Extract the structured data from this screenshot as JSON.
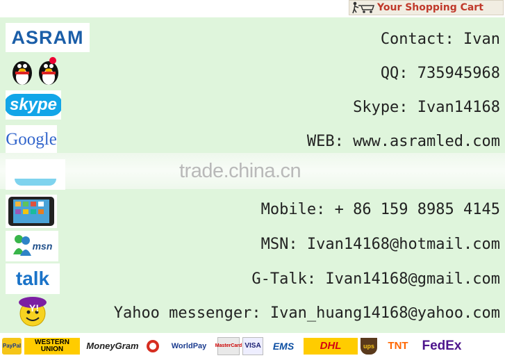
{
  "cart": {
    "label": "Your Shopping Cart",
    "icon": "cart-icon"
  },
  "contacts": {
    "logo_text": "ASRAM",
    "rows": [
      {
        "text": "Contact: Ivan",
        "icon": "asram-logo"
      },
      {
        "text": "QQ: 735945968",
        "icon": "qq-penguins-icon"
      },
      {
        "text": "Skype: Ivan14168",
        "icon": "skype-icon",
        "icon_label": "skype"
      },
      {
        "text": "WEB: www.asramled.com",
        "icon": "google-icon",
        "icon_label": "Google"
      },
      {
        "text": "",
        "icon": "blank-icon"
      },
      {
        "text": "Mobile: + 86 159 8985 4145",
        "icon": "tablet-icon"
      },
      {
        "text": "MSN: Ivan14168@hotmail.com",
        "icon": "msn-icon",
        "icon_label": "msn"
      },
      {
        "text": "G-Talk: Ivan14168@gmail.com",
        "icon": "gtalk-icon",
        "icon_label": "talk"
      },
      {
        "text": "Yahoo messenger: Ivan_huang14168@yahoo.com",
        "icon": "yahoo-icon",
        "icon_label": "Y!"
      }
    ]
  },
  "watermark": "trade.china.cn",
  "payments": [
    "PayPal",
    "WESTERN UNION",
    "MoneyGram",
    "WorldPay",
    "MasterCard",
    "VISA",
    "EMS",
    "DHL",
    "ups",
    "TNT",
    "FedEx"
  ]
}
